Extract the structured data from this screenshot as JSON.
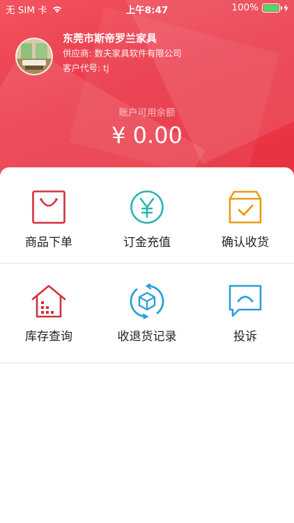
{
  "status_bar": {
    "carrier": "无 SIM 卡",
    "time": "上午8:47",
    "battery": "100%"
  },
  "profile": {
    "company": "东莞市斯帝罗兰家具",
    "supplier": "供应商: 数夫家具软件有限公司",
    "customer_code": "客户代号: tj"
  },
  "account": {
    "label": "账户可用余额",
    "balance": "¥ 0.00"
  },
  "menu": {
    "row1": [
      {
        "label": "商品下单",
        "icon": "shopping-bag-icon"
      },
      {
        "label": "订金充值",
        "icon": "yen-coin-icon"
      },
      {
        "label": "确认收货",
        "icon": "checked-box-icon"
      }
    ],
    "row2": [
      {
        "label": "库存查询",
        "icon": "warehouse-icon"
      },
      {
        "label": "收退货记录",
        "icon": "cube-refresh-icon"
      },
      {
        "label": "投诉",
        "icon": "chat-bubble-icon"
      }
    ]
  },
  "colors": {
    "header_red": "#e8323f",
    "icon_red": "#d62f3c",
    "icon_teal": "#2bb5b0",
    "icon_orange": "#eb9a13",
    "icon_blue": "#2a9fd8"
  }
}
